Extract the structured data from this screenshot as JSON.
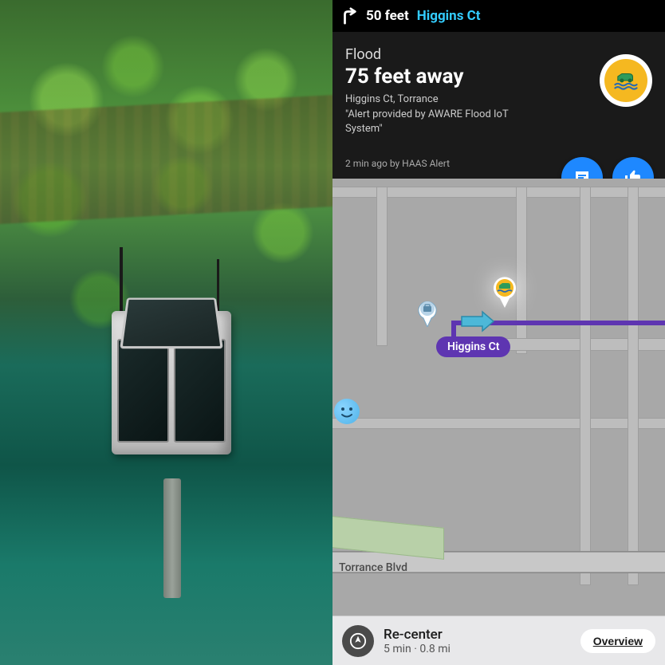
{
  "turn": {
    "distance": "50 feet",
    "street": "Higgins Ct"
  },
  "alert": {
    "title": "Flood",
    "distance": "75 feet away",
    "location": "Higgins Ct, Torrance",
    "description": "\"Alert provided by AWARE Flood IoT System\"",
    "reported": "2 min ago by HAAS Alert"
  },
  "map": {
    "route_street": "Higgins Ct",
    "cross_street": "Torrance Blvd"
  },
  "bottombar": {
    "recenter_label": "Re-center",
    "eta": "5 min · 0.8 mi",
    "overview_label": "Overview"
  }
}
